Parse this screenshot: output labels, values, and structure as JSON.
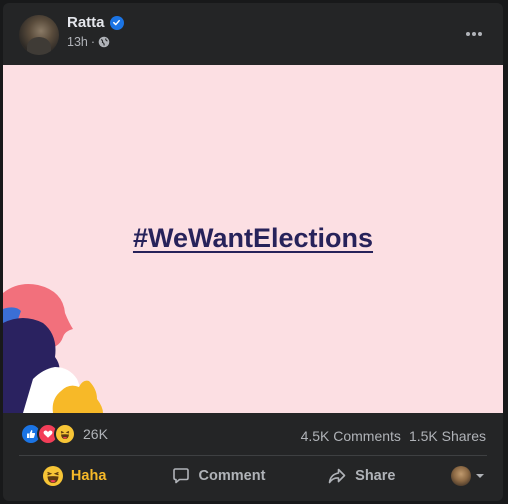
{
  "post": {
    "author": "Ratta",
    "time": "13h",
    "separator": "·",
    "image_text": "#WeWantElections"
  },
  "colors": {
    "image_background": "#fcdfe3",
    "hashtag": "#27225a",
    "haha_color": "#f7b928",
    "verified_badge": "#1b74e4"
  },
  "icons": {
    "verified": "verified-badge-icon",
    "privacy": "globe-icon",
    "more": "more-horizontal-icon",
    "reactions": [
      "like-icon",
      "love-icon",
      "haha-icon"
    ],
    "comment": "comment-icon",
    "share": "share-icon",
    "audience_dropdown": "chevron-down-icon"
  },
  "stats": {
    "reaction_count": "26K",
    "comments": "4.5K Comments",
    "shares": "1.5K Shares"
  },
  "actions": {
    "react_label": "Haha",
    "comment_label": "Comment",
    "share_label": "Share"
  }
}
